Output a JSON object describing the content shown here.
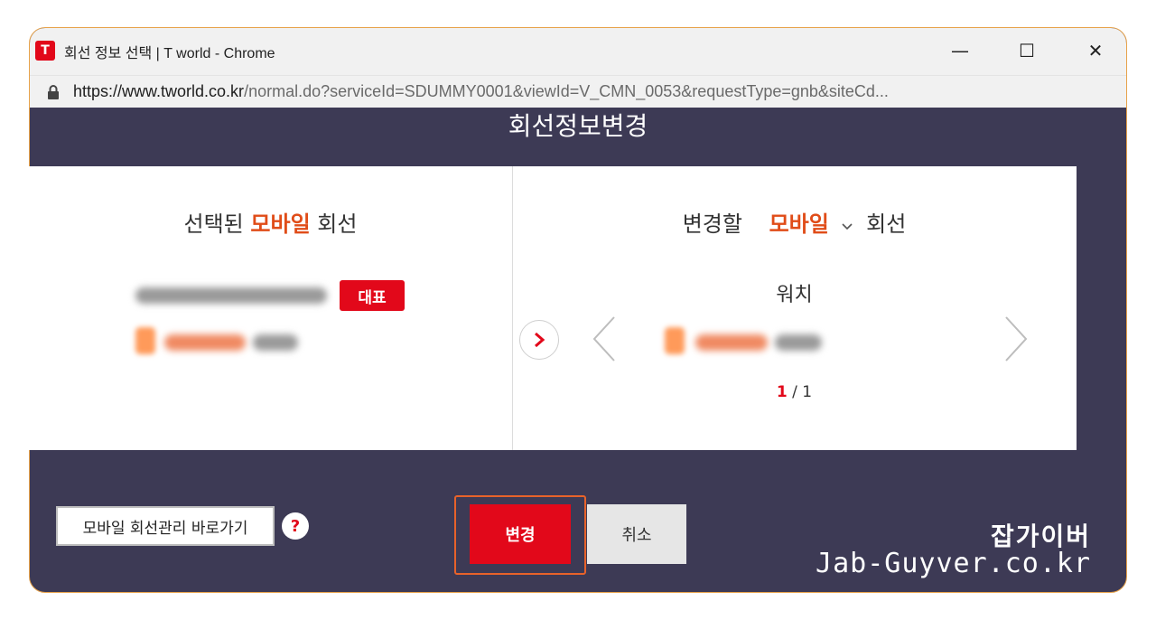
{
  "window": {
    "title": "회선 정보 선택 | T world - Chrome",
    "logo_glyph": "T",
    "minimize": "—",
    "maximize": "☐",
    "close": "✕"
  },
  "address": {
    "host": "https://www.tworld.co.kr",
    "path": "/normal.do?serviceId=SDUMMY0001&viewId=V_CMN_0053&requestType=gnb&siteCd..."
  },
  "dialog": {
    "heading": "회선정보변경",
    "selected": {
      "prefix": "선택된",
      "type": "모바일",
      "suffix": "회선",
      "badge": "대표"
    },
    "change": {
      "prefix": "변경할",
      "type": "모바일",
      "suffix": "회선",
      "device": "워치",
      "page_current": "1",
      "page_sep": " / ",
      "page_total": "1"
    },
    "shortcut_label": "모바일 회선관리 바로가기",
    "help_glyph": "?",
    "change_button": "변경",
    "cancel_button": "취소"
  },
  "watermark": {
    "korean": "잡가이버",
    "english": "Jab-Guyver.co.kr"
  },
  "colors": {
    "accent_red": "#e2081a",
    "accent_orange": "#e04c18",
    "dialog_bg": "#3d3a55"
  }
}
